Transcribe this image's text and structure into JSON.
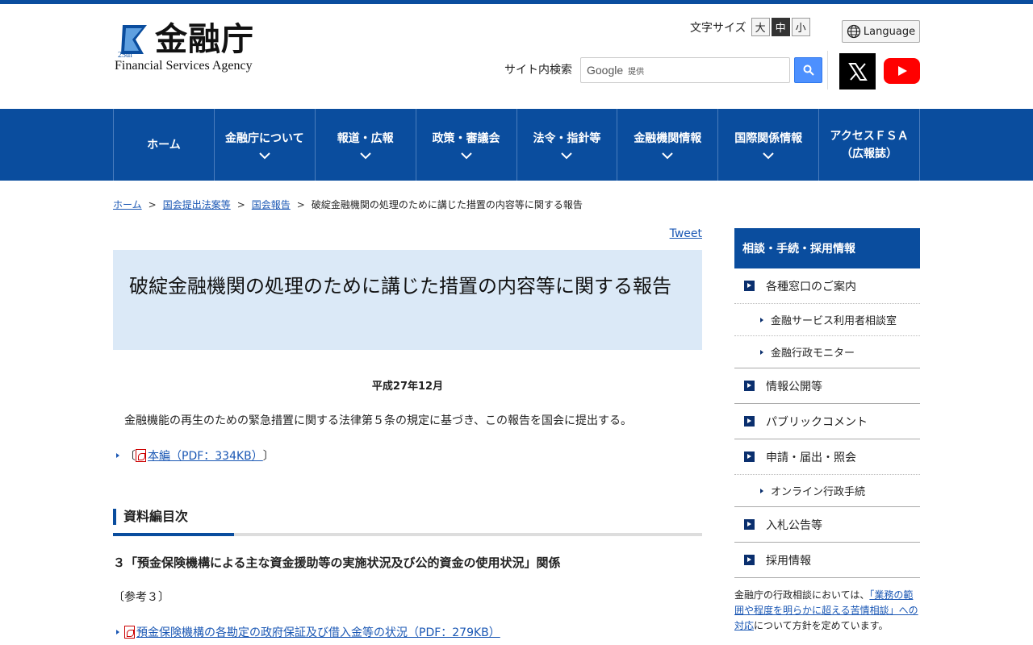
{
  "header": {
    "logo_jp": "金融庁",
    "logo_en": "Financial Services Agency",
    "logo_mark_text": "25th",
    "fontsize_label": "文字サイズ",
    "fontsize_options": [
      "大",
      "中",
      "小"
    ],
    "language_label": "Language",
    "search_label": "サイト内検索",
    "search_google": "Google",
    "search_provided": "提供"
  },
  "nav": {
    "items": [
      {
        "label": "ホーム"
      },
      {
        "label": "金融庁について"
      },
      {
        "label": "報道・広報"
      },
      {
        "label": "政策・審議会"
      },
      {
        "label": "法令・指針等"
      },
      {
        "label": "金融機関情報"
      },
      {
        "label": "国際関係情報"
      },
      {
        "label_line1": "アクセスＦＳＡ",
        "label_line2": "（広報誌）"
      }
    ]
  },
  "breadcrumb": {
    "items": [
      "ホーム",
      "国会提出法案等",
      "国会報告"
    ],
    "current": "破綻金融機関の処理のために講じた措置の内容等に関する報告",
    "sep": ">"
  },
  "content": {
    "tweet": "Tweet",
    "title": "破綻金融機関の処理のために講じた措置の内容等に関する報告",
    "date": "平成27年12月",
    "paragraph": "金融機能の再生のための緊急措置に関する法律第５条の規定に基づき、この報告を国会に提出する。",
    "main_link": "本編（PDF：334KB）",
    "bracket_open": "〔",
    "bracket_close": "〕",
    "section_heading": "資料編目次",
    "sub_heading": "３「預金保険機構による主な資金援助等の実施状況及び公的資金の使用状況」関係",
    "ref_label": "〔参考３〕",
    "ref_link": "預金保険機構の各勘定の政府保証及び借入金等の状況（PDF：279KB）"
  },
  "sidebar": {
    "heading": "相談・手続・採用情報",
    "item_madoguchi": "各種窓口のご案内",
    "sub_riyosha": "金融サービス利用者相談室",
    "sub_monitor": "金融行政モニター",
    "item_joho": "情報公開等",
    "item_public": "パブリックコメント",
    "item_shinsei": "申請・届出・照会",
    "sub_online": "オンライン行政手続",
    "item_nyusatsu": "入札公告等",
    "item_saiyo": "採用情報",
    "note_before": "金融庁の行政相談においては、",
    "note_link": "「業務の範囲や程度を明らかに超える苦情相談」への対応",
    "note_after": "について方針を定めています。"
  },
  "colors": {
    "brand": "#0a4d9e",
    "title_bg": "#dbe9f7",
    "link": "#1a57b4",
    "youtube": "#ff0000"
  }
}
